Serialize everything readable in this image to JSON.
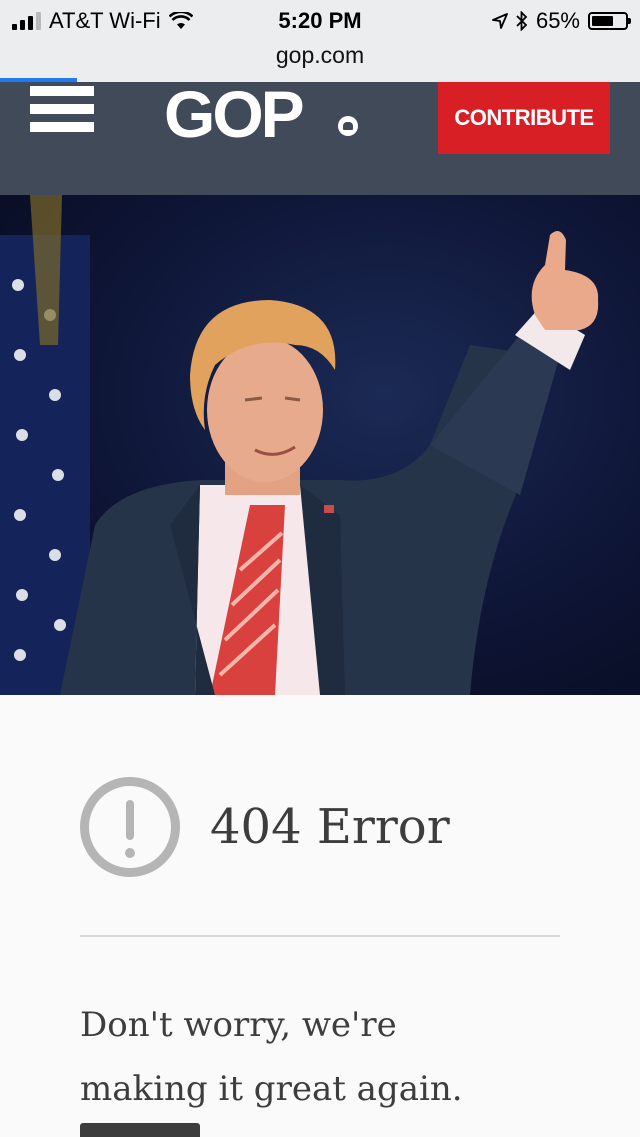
{
  "status_bar": {
    "carrier": "AT&T Wi-Fi",
    "time": "5:20 PM",
    "battery_percent": "65%",
    "battery_level": 0.65,
    "icons": [
      "signal-icon",
      "wifi-icon",
      "location-icon",
      "bluetooth-icon",
      "battery-icon"
    ]
  },
  "url_bar": {
    "domain": "gop.com",
    "load_progress": 0.12
  },
  "header": {
    "logo_text": "GOP",
    "contribute_label": "CONTRIBUTE",
    "colors": {
      "header_bg": "#414a59",
      "contribute_bg": "#d91f26"
    }
  },
  "hero": {
    "image": "hero-photo"
  },
  "main": {
    "error_icon": "exclamation-circle-icon",
    "error_title": "404 Error",
    "message_line1": "Don't worry, we're",
    "message_line2": "making it great again."
  }
}
